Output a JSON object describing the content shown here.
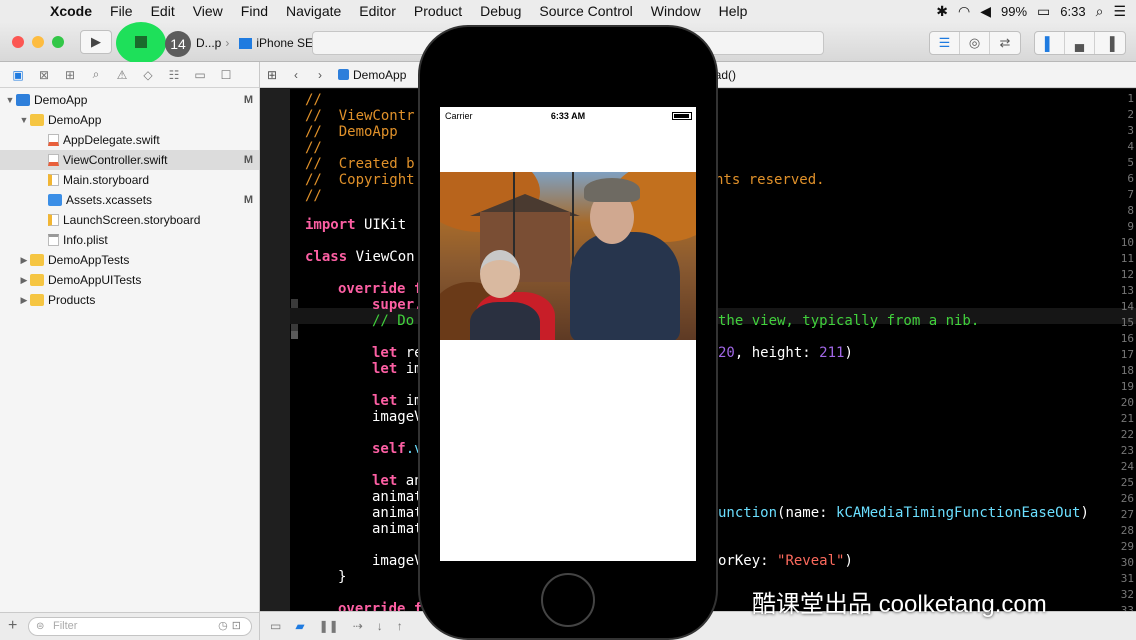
{
  "menubar": {
    "app": "Xcode",
    "items": [
      "File",
      "Edit",
      "View",
      "Find",
      "Navigate",
      "Editor",
      "Product",
      "Debug",
      "Source Control",
      "Window",
      "Help"
    ],
    "battery": "99%",
    "time": "6:33"
  },
  "toolbar": {
    "badge": "14",
    "scheme_short": "D...p",
    "device": "iPhone SE"
  },
  "navigator": {
    "items": [
      {
        "label": "DemoApp",
        "status": "M"
      },
      {
        "label": "DemoApp",
        "status": ""
      },
      {
        "label": "AppDelegate.swift",
        "status": ""
      },
      {
        "label": "ViewController.swift",
        "status": "M"
      },
      {
        "label": "Main.storyboard",
        "status": ""
      },
      {
        "label": "Assets.xcassets",
        "status": "M"
      },
      {
        "label": "LaunchScreen.storyboard",
        "status": ""
      },
      {
        "label": "Info.plist",
        "status": ""
      },
      {
        "label": "DemoAppTests",
        "status": ""
      },
      {
        "label": "DemoAppUITests",
        "status": ""
      },
      {
        "label": "Products",
        "status": ""
      }
    ],
    "filter_placeholder": "Filter"
  },
  "jumpbar": {
    "crumb": "DemoApp",
    "function": "oad()"
  },
  "editor": {
    "line_numbers": [
      "1",
      "2",
      "3",
      "4",
      "5",
      "6",
      "7",
      "8",
      "9",
      "10",
      "11",
      "12",
      "13",
      "14",
      "15",
      "16",
      "17",
      "18",
      "19",
      "20",
      "21",
      "22",
      "23",
      "24",
      "25",
      "26",
      "27",
      "28",
      "29",
      "30",
      "31",
      "32",
      "33"
    ],
    "lines": {
      "l1": "//",
      "l2": "//  ViewContr",
      "l3": "//  DemoApp",
      "l4": "//",
      "l5": "//  Created b",
      "l6": "//  Copyright",
      "l6b": "hts reserved.",
      "l7": "//",
      "l9a": "import",
      "l9b": " UIKit",
      "l11a": "class",
      "l11b": " ViewCon",
      "l13a": "override",
      "l13b": " f",
      "l14": "super.",
      "l15a": "// Do",
      "l15b": "the view, typically from a nib.",
      "l17a": "let",
      "l17b": " re",
      "l17c": "20",
      "l17d": ", height: ",
      "l17e": "211",
      "l17f": ")",
      "l18a": "let",
      "l18b": " im",
      "l20a": "let",
      "l20b": " im",
      "l21": "imageV",
      "l23a": "self",
      "l23b": ".v",
      "l25a": "let",
      "l25b": " an",
      "l26": "animat",
      "l27a": "animat",
      "l27b": "unction",
      "l27c": "(name: ",
      "l27d": "kCAMediaTimingFunctionEaseOut",
      "l27e": ")",
      "l28": "animat",
      "l30a": "imageV",
      "l30b": "orKey: ",
      "l30c": "\"Reveal\"",
      "l30d": ")",
      "l31": "}",
      "l33a": "override",
      "l33b": " f"
    }
  },
  "simulator": {
    "carrier": "Carrier",
    "time": "6:33 AM"
  },
  "watermark": "酷课堂出品 coolketang.com",
  "colors": {
    "keyword": "#fc5fa3",
    "comment": "#e0912a",
    "green_comment": "#41d13c",
    "number": "#a167e6",
    "string": "#fc6a5d",
    "accent": "#1f7be0",
    "stop_highlight": "#1ee05a"
  }
}
